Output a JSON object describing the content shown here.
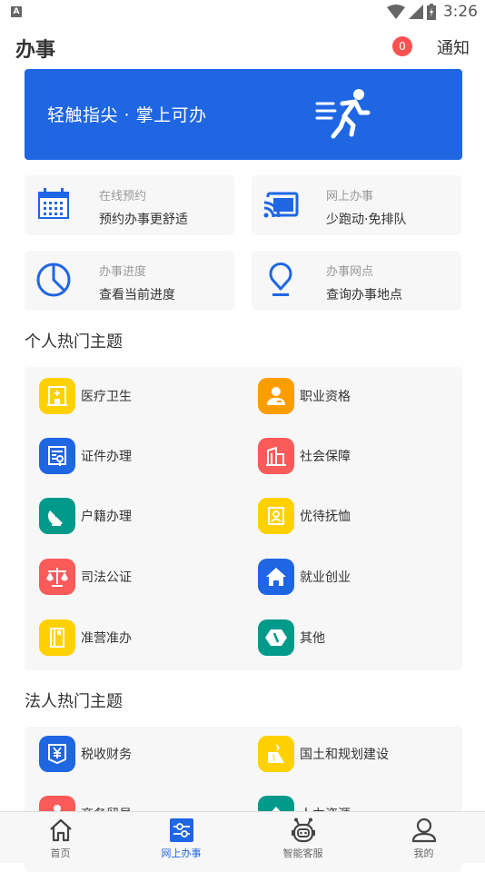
{
  "status_bar": {
    "time": "3:26",
    "indicator": "A"
  },
  "header": {
    "title": "办事",
    "notification_count": "0",
    "notification_label": "通知"
  },
  "banner": {
    "text": "轻触指尖 · 掌上可办",
    "icon": "running-person-icon"
  },
  "quick_actions": [
    {
      "title": "在线预约",
      "subtitle": "预约办事更舒适",
      "icon": "calendar-icon"
    },
    {
      "title": "网上办事",
      "subtitle": "少跑动·免排队",
      "icon": "cast-screen-icon"
    },
    {
      "title": "办事进度",
      "subtitle": "查看当前进度",
      "icon": "pie-progress-icon"
    },
    {
      "title": "办事网点",
      "subtitle": "查询办事地点",
      "icon": "location-pin-icon"
    }
  ],
  "personal_section": {
    "title": "个人热门主题",
    "items": [
      {
        "label": "医疗卫生",
        "icon": "hospital-icon",
        "color": "#ffd100"
      },
      {
        "label": "职业资格",
        "icon": "person-badge-icon",
        "color": "#ff9d00"
      },
      {
        "label": "证件办理",
        "icon": "certificate-icon",
        "color": "#1f66e3"
      },
      {
        "label": "社会保障",
        "icon": "buildings-icon",
        "color": "#fa5a5a"
      },
      {
        "label": "户籍办理",
        "icon": "satellite-dish-icon",
        "color": "#009a8a"
      },
      {
        "label": "优待抚恤",
        "icon": "portrait-icon",
        "color": "#ffd100"
      },
      {
        "label": "司法公证",
        "icon": "scales-icon",
        "color": "#fa5a5a"
      },
      {
        "label": "就业创业",
        "icon": "house-icon",
        "color": "#1f66e3"
      },
      {
        "label": "准营准办",
        "icon": "book-icon",
        "color": "#ffd100"
      },
      {
        "label": "其他",
        "icon": "hexagon-icon",
        "color": "#009a8a"
      }
    ]
  },
  "corporate_section": {
    "title": "法人热门主题",
    "items": [
      {
        "label": "税收财务",
        "icon": "yuan-shield-icon",
        "color": "#1f66e3"
      },
      {
        "label": "国土和规划建设",
        "icon": "construction-icon",
        "color": "#ffd100"
      },
      {
        "label": "商务贸易",
        "icon": "trade-person-icon",
        "color": "#fa5a5a"
      },
      {
        "label": "人力资源",
        "icon": "human-resources-icon",
        "color": "#009a8a"
      }
    ]
  },
  "tab_bar": [
    {
      "label": "首页",
      "icon": "home-icon",
      "active": false
    },
    {
      "label": "网上办事",
      "icon": "sliders-icon",
      "active": true
    },
    {
      "label": "智能客服",
      "icon": "robot-icon",
      "active": false
    },
    {
      "label": "我的",
      "icon": "user-icon",
      "active": false
    }
  ],
  "colors": {
    "accent": "#1f66e3",
    "badge": "#fa5151",
    "card_bg": "#f7f7f8"
  }
}
